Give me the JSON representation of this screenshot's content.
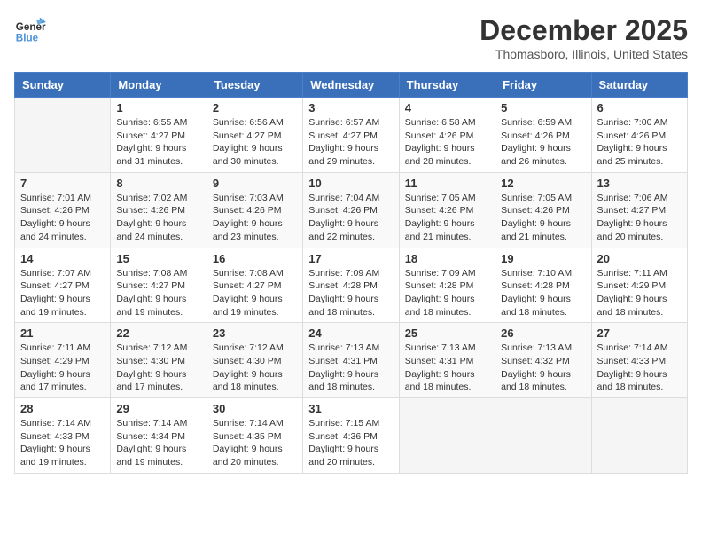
{
  "logo": {
    "line1": "General",
    "line2": "Blue"
  },
  "title": "December 2025",
  "location": "Thomasboro, Illinois, United States",
  "weekdays": [
    "Sunday",
    "Monday",
    "Tuesday",
    "Wednesday",
    "Thursday",
    "Friday",
    "Saturday"
  ],
  "weeks": [
    [
      {
        "day": "",
        "info": ""
      },
      {
        "day": "1",
        "info": "Sunrise: 6:55 AM\nSunset: 4:27 PM\nDaylight: 9 hours\nand 31 minutes."
      },
      {
        "day": "2",
        "info": "Sunrise: 6:56 AM\nSunset: 4:27 PM\nDaylight: 9 hours\nand 30 minutes."
      },
      {
        "day": "3",
        "info": "Sunrise: 6:57 AM\nSunset: 4:27 PM\nDaylight: 9 hours\nand 29 minutes."
      },
      {
        "day": "4",
        "info": "Sunrise: 6:58 AM\nSunset: 4:26 PM\nDaylight: 9 hours\nand 28 minutes."
      },
      {
        "day": "5",
        "info": "Sunrise: 6:59 AM\nSunset: 4:26 PM\nDaylight: 9 hours\nand 26 minutes."
      },
      {
        "day": "6",
        "info": "Sunrise: 7:00 AM\nSunset: 4:26 PM\nDaylight: 9 hours\nand 25 minutes."
      }
    ],
    [
      {
        "day": "7",
        "info": "Sunrise: 7:01 AM\nSunset: 4:26 PM\nDaylight: 9 hours\nand 24 minutes."
      },
      {
        "day": "8",
        "info": "Sunrise: 7:02 AM\nSunset: 4:26 PM\nDaylight: 9 hours\nand 24 minutes."
      },
      {
        "day": "9",
        "info": "Sunrise: 7:03 AM\nSunset: 4:26 PM\nDaylight: 9 hours\nand 23 minutes."
      },
      {
        "day": "10",
        "info": "Sunrise: 7:04 AM\nSunset: 4:26 PM\nDaylight: 9 hours\nand 22 minutes."
      },
      {
        "day": "11",
        "info": "Sunrise: 7:05 AM\nSunset: 4:26 PM\nDaylight: 9 hours\nand 21 minutes."
      },
      {
        "day": "12",
        "info": "Sunrise: 7:05 AM\nSunset: 4:26 PM\nDaylight: 9 hours\nand 21 minutes."
      },
      {
        "day": "13",
        "info": "Sunrise: 7:06 AM\nSunset: 4:27 PM\nDaylight: 9 hours\nand 20 minutes."
      }
    ],
    [
      {
        "day": "14",
        "info": "Sunrise: 7:07 AM\nSunset: 4:27 PM\nDaylight: 9 hours\nand 19 minutes."
      },
      {
        "day": "15",
        "info": "Sunrise: 7:08 AM\nSunset: 4:27 PM\nDaylight: 9 hours\nand 19 minutes."
      },
      {
        "day": "16",
        "info": "Sunrise: 7:08 AM\nSunset: 4:27 PM\nDaylight: 9 hours\nand 19 minutes."
      },
      {
        "day": "17",
        "info": "Sunrise: 7:09 AM\nSunset: 4:28 PM\nDaylight: 9 hours\nand 18 minutes."
      },
      {
        "day": "18",
        "info": "Sunrise: 7:09 AM\nSunset: 4:28 PM\nDaylight: 9 hours\nand 18 minutes."
      },
      {
        "day": "19",
        "info": "Sunrise: 7:10 AM\nSunset: 4:28 PM\nDaylight: 9 hours\nand 18 minutes."
      },
      {
        "day": "20",
        "info": "Sunrise: 7:11 AM\nSunset: 4:29 PM\nDaylight: 9 hours\nand 18 minutes."
      }
    ],
    [
      {
        "day": "21",
        "info": "Sunrise: 7:11 AM\nSunset: 4:29 PM\nDaylight: 9 hours\nand 17 minutes."
      },
      {
        "day": "22",
        "info": "Sunrise: 7:12 AM\nSunset: 4:30 PM\nDaylight: 9 hours\nand 17 minutes."
      },
      {
        "day": "23",
        "info": "Sunrise: 7:12 AM\nSunset: 4:30 PM\nDaylight: 9 hours\nand 18 minutes."
      },
      {
        "day": "24",
        "info": "Sunrise: 7:13 AM\nSunset: 4:31 PM\nDaylight: 9 hours\nand 18 minutes."
      },
      {
        "day": "25",
        "info": "Sunrise: 7:13 AM\nSunset: 4:31 PM\nDaylight: 9 hours\nand 18 minutes."
      },
      {
        "day": "26",
        "info": "Sunrise: 7:13 AM\nSunset: 4:32 PM\nDaylight: 9 hours\nand 18 minutes."
      },
      {
        "day": "27",
        "info": "Sunrise: 7:14 AM\nSunset: 4:33 PM\nDaylight: 9 hours\nand 18 minutes."
      }
    ],
    [
      {
        "day": "28",
        "info": "Sunrise: 7:14 AM\nSunset: 4:33 PM\nDaylight: 9 hours\nand 19 minutes."
      },
      {
        "day": "29",
        "info": "Sunrise: 7:14 AM\nSunset: 4:34 PM\nDaylight: 9 hours\nand 19 minutes."
      },
      {
        "day": "30",
        "info": "Sunrise: 7:14 AM\nSunset: 4:35 PM\nDaylight: 9 hours\nand 20 minutes."
      },
      {
        "day": "31",
        "info": "Sunrise: 7:15 AM\nSunset: 4:36 PM\nDaylight: 9 hours\nand 20 minutes."
      },
      {
        "day": "",
        "info": ""
      },
      {
        "day": "",
        "info": ""
      },
      {
        "day": "",
        "info": ""
      }
    ]
  ]
}
